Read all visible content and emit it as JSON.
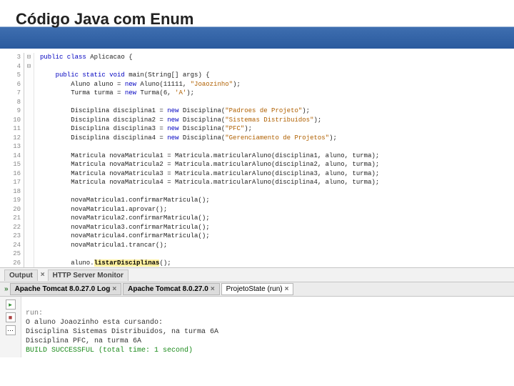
{
  "title": "Código Java com Enum",
  "gutter_start": 3,
  "gutter_end": 26,
  "code_lines": [
    {
      "i": 0,
      "cls": "kw",
      "text": "public class ",
      "after": "Aplicacao {"
    },
    {
      "i": 2,
      "cls": "kw",
      "text": "    public static void ",
      "after": "main(String[] args) {"
    },
    {
      "i": 3,
      "text": "        Aluno aluno = ",
      "kw": "new",
      "after": " Aluno(11111, ",
      "str": "\"Joaozinho\"",
      "tail": ");"
    },
    {
      "i": 4,
      "text": "        Turma turma = ",
      "kw": "new",
      "after": " Turma(6, ",
      "str": "'A'",
      "tail": ");"
    },
    {
      "i": 5,
      "text": ""
    },
    {
      "i": 6,
      "text": "        Disciplina disciplina1 = ",
      "kw": "new",
      "after": " Disciplina(",
      "str": "\"Padroes de Projeto\"",
      "tail": ");"
    },
    {
      "i": 7,
      "text": "        Disciplina disciplina2 = ",
      "kw": "new",
      "after": " Disciplina(",
      "str": "\"Sistemas Distribuidos\"",
      "tail": ");"
    },
    {
      "i": 8,
      "text": "        Disciplina disciplina3 = ",
      "kw": "new",
      "after": " Disciplina(",
      "str": "\"PFC\"",
      "tail": ");"
    },
    {
      "i": 9,
      "text": "        Disciplina disciplina4 = ",
      "kw": "new",
      "after": " Disciplina(",
      "str": "\"Gerenciamento de Projetos\"",
      "tail": ");"
    },
    {
      "i": 10,
      "text": ""
    },
    {
      "i": 11,
      "text": "        Matricula novaMatricula1 = Matricula.matricularAluno(disciplina1, aluno, turma);"
    },
    {
      "i": 12,
      "text": "        Matricula novaMatricula2 = Matricula.matricularAluno(disciplina2, aluno, turma);"
    },
    {
      "i": 13,
      "text": "        Matricula novaMatricula3 = Matricula.matricularAluno(disciplina3, aluno, turma);"
    },
    {
      "i": 14,
      "text": "        Matricula novaMatricula4 = Matricula.matricularAluno(disciplina4, aluno, turma);"
    },
    {
      "i": 15,
      "text": ""
    },
    {
      "i": 16,
      "text": "        novaMatricula1.confirmarMatricula();"
    },
    {
      "i": 17,
      "text": "        novaMatricula1.aprovar();"
    },
    {
      "i": 18,
      "text": "        novaMatricula2.confirmarMatricula();"
    },
    {
      "i": 19,
      "text": "        novaMatricula3.confirmarMatricula();"
    },
    {
      "i": 20,
      "text": "        novaMatricula4.confirmarMatricula();"
    },
    {
      "i": 21,
      "text": "        novaMatricula1.trancar();"
    },
    {
      "i": 22,
      "text": ""
    },
    {
      "i": 23,
      "text": "        aluno.",
      "warn": "listarDisciplinas",
      "tail": "();"
    }
  ],
  "bottom_tabs": {
    "output": "Output",
    "http": "HTTP Server Monitor",
    "close": "×"
  },
  "output_tabs": {
    "t1": "Apache Tomcat 8.0.27.0 Log",
    "t2": "Apache Tomcat 8.0.27.0",
    "t3": "ProjetoState (run)",
    "close": "×",
    "arrow": "»"
  },
  "console": {
    "run": "run:",
    "l1": "O aluno Joaozinho esta cursando:",
    "l2": "Disciplina Sistemas Distribuidos, na turma 6A",
    "l3": "Disciplina PFC, na turma 6A",
    "build": "BUILD SUCCESSFUL (total time: 1 second)"
  }
}
